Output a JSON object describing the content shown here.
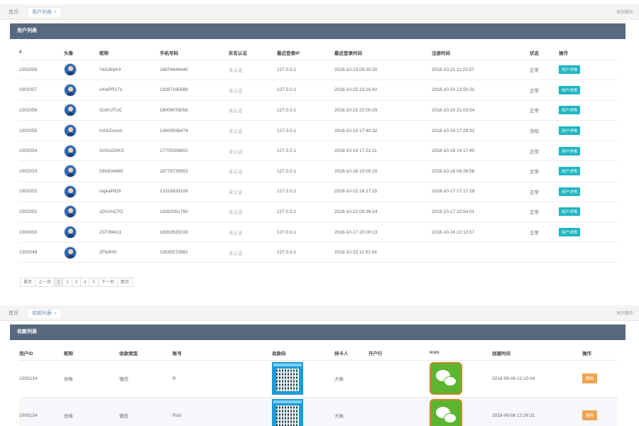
{
  "top_tabs": {
    "home": "首页",
    "active": "用户列表",
    "close_ops": "关闭操作"
  },
  "users_panel": {
    "title": "用户列表",
    "columns": [
      "#",
      "头像",
      "昵称",
      "手机号码",
      "实名认证",
      "最近登录IP",
      "最近登录时间",
      "注册时间",
      "状态",
      "操作"
    ],
    "rows": [
      {
        "id": "1002058",
        "nick": "YkILWpK9",
        "phone": "18974444440",
        "verify": "未认证",
        "ip": "127.0.0.1",
        "last": "2018-10-23 09:30:30",
        "reg": "2018-10-21 11:22:07",
        "status": "正常",
        "action": "用户详情"
      },
      {
        "id": "1002057",
        "nick": "sXwPR1Tx",
        "phone": "13267190589",
        "verify": "未认证",
        "ip": "127.0.0.1",
        "last": "2018-10-22 23:16:42",
        "reg": "2018-10-20 23:50:31",
        "status": "正常",
        "action": "用户详情"
      },
      {
        "id": "1002056",
        "nick": "lCoKUTUC",
        "phone": "18009076056",
        "verify": "未认证",
        "ip": "127.0.0.1",
        "last": "2018-10-22 22:00:29",
        "reg": "2018-10-20 21:03:54",
        "status": "正常",
        "action": "用户详情"
      },
      {
        "id": "1002055",
        "nick": "HASZxxAd",
        "phone": "13600938474",
        "verify": "未认证",
        "ip": "127.0.0.1",
        "last": "2018-10-19 17:40:32",
        "reg": "2018-10-19 17:29:32",
        "status": "冻结",
        "action": "用户详情"
      },
      {
        "id": "1002054",
        "nick": "SASsGDKS",
        "phone": "17705306601",
        "verify": "未认证",
        "ip": "127.0.0.1",
        "last": "2018-10-19 17:22:11",
        "reg": "2018-10-18 14:17:45",
        "status": "正常",
        "action": "用户详情"
      },
      {
        "id": "1002053",
        "nick": "DRdG4iW9",
        "phone": "18776729953",
        "verify": "未认证",
        "ip": "127.0.0.1",
        "last": "2018-10-18 10:05:15",
        "reg": "2018-10-18 09:26:56",
        "status": "正常",
        "action": "用户详情"
      },
      {
        "id": "1002052",
        "nick": "ingkaPtD9",
        "phone": "13318933109",
        "verify": "未认证",
        "ip": "127.0.0.1",
        "last": "2018-10-22 18:17:15",
        "reg": "2018-10-17 17:17:29",
        "status": "正常",
        "action": "用户详情"
      },
      {
        "id": "1002051",
        "nick": "sDVzHZTO",
        "phone": "18392061760",
        "verify": "未认证",
        "ip": "127.0.0.1",
        "last": "2018-10-22 09:39:14",
        "reg": "2018-10-17 10:54:01",
        "status": "正常",
        "action": "用户详情"
      },
      {
        "id": "1002050",
        "nick": "Z3T3M411",
        "phone": "18302625019",
        "verify": "未认证",
        "ip": "127.0.0.1",
        "last": "2018-10-17 20:00:13",
        "reg": "2018-10-16 22:10:57",
        "status": "正常",
        "action": "用户详情"
      },
      {
        "id": "1002049",
        "nick": "ZFb0HS",
        "phone": "13530272881",
        "verify": "未认证",
        "ip": "127.0.0.1",
        "last": "2018-10-23 11:01:54",
        "reg": "",
        "status": "",
        "action": ""
      }
    ],
    "pager": [
      "首页",
      "上一页",
      "1",
      "2",
      "3",
      "4",
      "5",
      "下一页",
      "尾页"
    ]
  },
  "bottom_tabs": {
    "home": "首页",
    "active": "收款列表",
    "close_ops": "关闭操作"
  },
  "pay_panel": {
    "title": "收款列表",
    "columns": [
      "用户ID",
      "昵称",
      "收款类型",
      "账号",
      "收款码",
      "持卡人",
      "开户行",
      "icon",
      "创建时间",
      "操作"
    ],
    "rows": [
      {
        "uid": "1000134",
        "nick": "仿咏",
        "type": "微信",
        "account": "R",
        "holder": "大咏",
        "bank": "",
        "created": "2018-06-06 12:10:04",
        "action": "删除"
      },
      {
        "uid": "1000134",
        "nick": "仿咏",
        "type": "微信",
        "account": "Rod",
        "holder": "大咏",
        "bank": "",
        "created": "2018-06-06 12:26:31",
        "action": "删除"
      }
    ]
  },
  "colors": {
    "header": "#56697f",
    "teal": "#1fb6c1",
    "orange": "#f0a44e",
    "wechat": "#5cb531"
  },
  "icons": {
    "avatar": "user-avatar-icon",
    "qr": "qr-code-icon",
    "wechat": "wechat-icon"
  }
}
